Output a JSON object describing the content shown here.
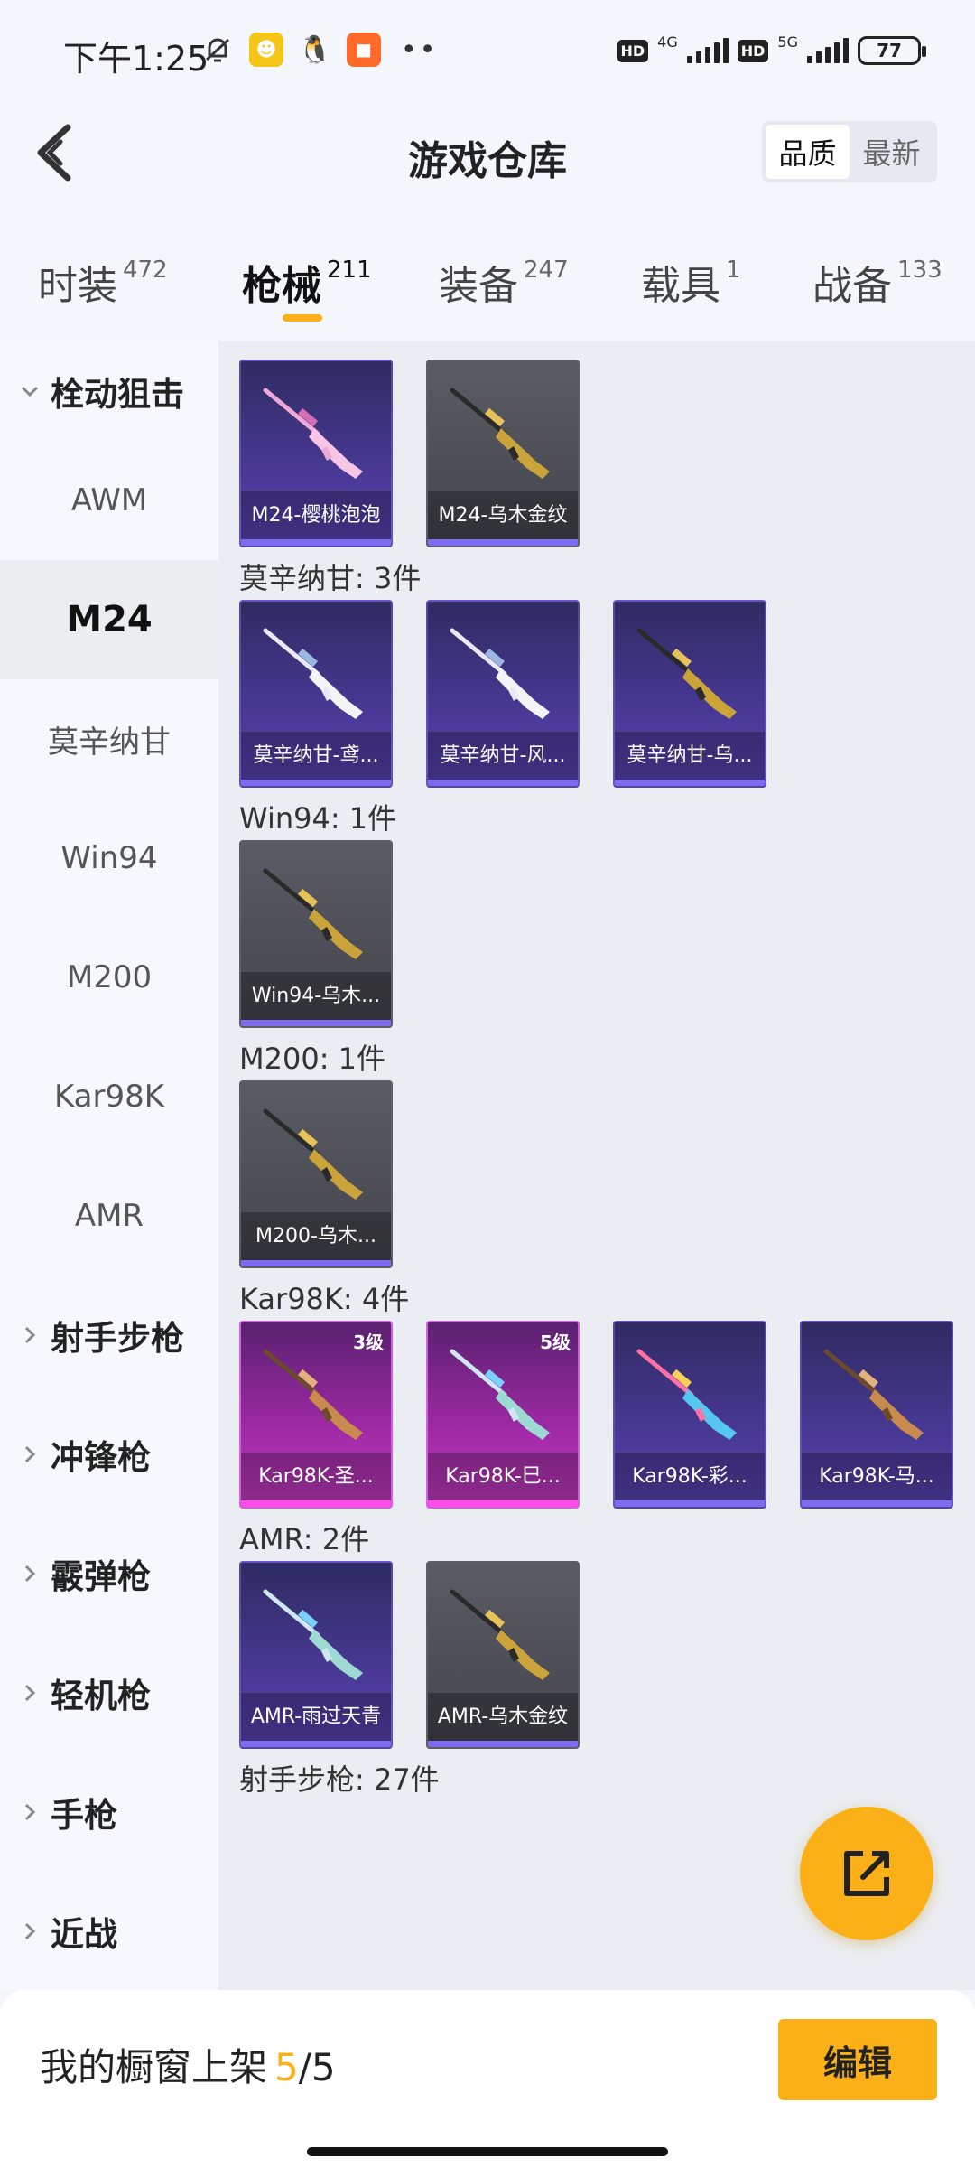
{
  "status_bar": {
    "time": "下午1:25",
    "net1": "4G",
    "net2": "5G",
    "battery": "77",
    "hd": "HD"
  },
  "header": {
    "title": "游戏仓库",
    "sort_options": [
      "品质",
      "最新"
    ],
    "active_sort": "品质"
  },
  "tabs": [
    {
      "label": "时装",
      "count": "472"
    },
    {
      "label": "枪械",
      "count": "211"
    },
    {
      "label": "装备",
      "count": "247"
    },
    {
      "label": "载具",
      "count": "1"
    },
    {
      "label": "战备",
      "count": "133"
    }
  ],
  "sidebar": {
    "items": [
      {
        "label": "栓动狙击",
        "type": "group",
        "expanded": true
      },
      {
        "label": "AWM",
        "type": "sub"
      },
      {
        "label": "M24",
        "type": "sub",
        "active": true
      },
      {
        "label": "莫辛纳甘",
        "type": "sub"
      },
      {
        "label": "Win94",
        "type": "sub"
      },
      {
        "label": "M200",
        "type": "sub"
      },
      {
        "label": "Kar98K",
        "type": "sub"
      },
      {
        "label": "AMR",
        "type": "sub"
      },
      {
        "label": "射手步枪",
        "type": "group"
      },
      {
        "label": "冲锋枪",
        "type": "group"
      },
      {
        "label": "霰弹枪",
        "type": "group"
      },
      {
        "label": "轻机枪",
        "type": "group"
      },
      {
        "label": "手枪",
        "type": "group"
      },
      {
        "label": "近战",
        "type": "group"
      }
    ]
  },
  "sections": [
    {
      "title": "",
      "items": [
        {
          "name": "M24-樱桃泡泡",
          "style": "purple",
          "gun": "pink"
        },
        {
          "name": "M24-乌木金纹",
          "style": "gray",
          "gun": "gold"
        }
      ]
    },
    {
      "title": "莫辛纳甘: 3件",
      "items": [
        {
          "name": "莫辛纳甘-鸢...",
          "style": "purple",
          "gun": "white"
        },
        {
          "name": "莫辛纳甘-风...",
          "style": "purple",
          "gun": "white"
        },
        {
          "name": "莫辛纳甘-乌...",
          "style": "purple",
          "gun": "gold"
        }
      ]
    },
    {
      "title": "Win94: 1件",
      "items": [
        {
          "name": "Win94-乌木...",
          "style": "gray",
          "gun": "gold"
        }
      ]
    },
    {
      "title": "M200: 1件",
      "items": [
        {
          "name": "M200-乌木...",
          "style": "gray",
          "gun": "gold"
        }
      ]
    },
    {
      "title": "Kar98K: 4件",
      "items": [
        {
          "name": "Kar98K-圣...",
          "style": "pink",
          "gun": "wood",
          "level": "3级"
        },
        {
          "name": "Kar98K-巳...",
          "style": "pink",
          "gun": "ice",
          "level": "5级"
        },
        {
          "name": "Kar98K-彩...",
          "style": "purple",
          "gun": "rainbow"
        },
        {
          "name": "Kar98K-马...",
          "style": "purple",
          "gun": "wood"
        }
      ]
    },
    {
      "title": "AMR: 2件",
      "items": [
        {
          "name": "AMR-雨过天青",
          "style": "purple",
          "gun": "ice"
        },
        {
          "name": "AMR-乌木金纹",
          "style": "gray",
          "gun": "gold"
        }
      ]
    },
    {
      "title": "射手步枪: 27件",
      "items": []
    }
  ],
  "bottom": {
    "showcase_label": "我的橱窗上架",
    "showcase_count": "5",
    "showcase_total": "/5",
    "edit_label": "编辑"
  },
  "colors": {
    "accent": "#fbb017",
    "background": "#f3f6fb",
    "content_bg": "#eaedf1"
  }
}
